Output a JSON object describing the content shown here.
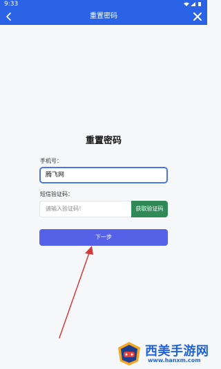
{
  "status_bar": {
    "time": "9:33"
  },
  "header": {
    "title": "重置密码"
  },
  "form": {
    "heading": "重置密码",
    "phone_label": "手机号：",
    "phone_value": "腾飞网",
    "code_label": "短信验证码：",
    "code_placeholder": "请输入验证码！",
    "get_code_label": "获取验证码",
    "next_label": "下一步"
  },
  "watermark": {
    "name": "西美手游网",
    "url": "www.hanxm.com"
  },
  "colors": {
    "header": "#2a63e6",
    "input_focus_border": "#4a74e6",
    "get_code_button": "#2f8a57",
    "next_button": "#5562e8",
    "annotation_arrow": "#d23b3b",
    "watermark_text": "#1f63d8"
  },
  "icons": [
    "back-arrow-icon",
    "close-icon",
    "wifi-icon",
    "signal-icon",
    "battery-icon",
    "annotation-arrow"
  ]
}
